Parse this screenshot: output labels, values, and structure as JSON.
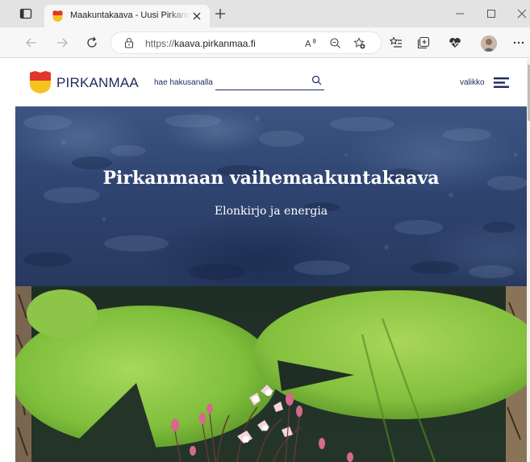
{
  "browser": {
    "tab": {
      "title": "Maakuntakaava - Uusi Pirkanmaa"
    },
    "url": {
      "protocol": "https://",
      "domain": "kaava.pirkanmaa.fi"
    },
    "icons": {
      "tab_actions": "tab-actions-icon",
      "close_tab": "close-icon",
      "new_tab": "plus-icon",
      "back": "arrow-left-icon",
      "forward": "arrow-right-icon",
      "refresh": "refresh-icon",
      "site_info": "lock-icon",
      "read_aloud": "read-aloud-icon",
      "zoom": "zoom-out-icon",
      "favorite": "star-add-icon",
      "favorites": "favorites-list-icon",
      "collections": "collections-icon",
      "health": "heart-pulse-icon",
      "profile": "avatar",
      "more": "more-icon"
    }
  },
  "site": {
    "logo_text": "PIRKANMAA",
    "search": {
      "label": "hae hakusanalla",
      "value": ""
    },
    "menu": {
      "label": "valikko"
    },
    "brand_colors": {
      "navy": "#1f2a5c",
      "red": "#e2362a",
      "yellow": "#f7c31e"
    }
  },
  "hero": {
    "title": "Pirkanmaan vaihemaakuntakaava",
    "subtitle": "Elonkirjo ja energia"
  }
}
